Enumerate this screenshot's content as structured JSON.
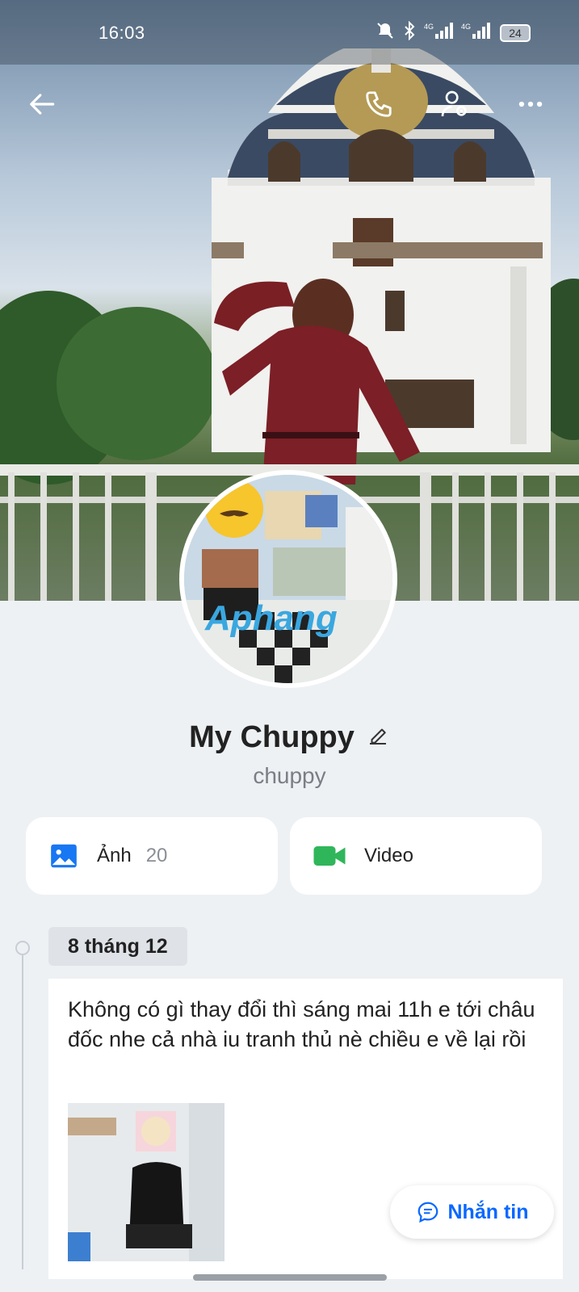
{
  "status_bar": {
    "time": "16:03",
    "battery": "24",
    "icons": [
      "bell-off-icon",
      "bluetooth-icon",
      "signal-4g-icon",
      "signal-4g-icon"
    ]
  },
  "header": {
    "back_icon": "arrow-left-icon",
    "call_icon": "phone-icon",
    "settings_icon": "user-settings-icon",
    "more_icon": "more-dots-icon"
  },
  "profile": {
    "name": "My Chuppy",
    "handle": "chuppy",
    "avatar_watermark": "Aphang"
  },
  "media": {
    "photos_label": "Ảnh",
    "photos_count": "20",
    "video_label": "Video"
  },
  "timeline": {
    "date": "8 tháng 12",
    "post_text": "Không có gì thay đổi thì sáng mai 11h e tới châu đốc nhe cả nhà iu tranh thủ nè chiều e về lại rồi"
  },
  "actions": {
    "message_label": "Nhắn tin"
  },
  "colors": {
    "accent": "#0a68ff",
    "video_green": "#2fb65a",
    "photo_blue": "#1877f2"
  }
}
